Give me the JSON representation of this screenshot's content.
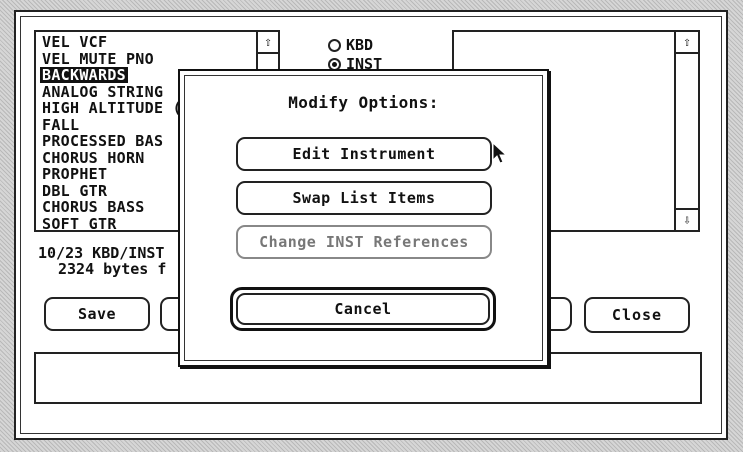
{
  "instrument_list": {
    "items": [
      {
        "label": "VEL VCF",
        "selected": false
      },
      {
        "label": "VEL MUTE PNO",
        "selected": false
      },
      {
        "label": "BACKWARDS",
        "selected": true
      },
      {
        "label": "ANALOG STRING",
        "selected": false
      },
      {
        "label": "HIGH ALTITUDE (",
        "selected": false
      },
      {
        "label": "FALL",
        "selected": false
      },
      {
        "label": "PROCESSED BAS",
        "selected": false
      },
      {
        "label": "CHORUS HORN",
        "selected": false
      },
      {
        "label": "PROPHET",
        "selected": false
      },
      {
        "label": "DBL GTR",
        "selected": false
      },
      {
        "label": "CHORUS BASS",
        "selected": false
      },
      {
        "label": "SOFT GTR",
        "selected": false
      }
    ]
  },
  "radios": {
    "kbd": {
      "label": "KBD",
      "checked": false
    },
    "inst": {
      "label": "INST",
      "checked": true
    }
  },
  "status": {
    "count_line": "10/23 KBD/INST",
    "bytes_line": "2324 bytes f"
  },
  "buttons": {
    "save_label": "Save",
    "close_label": "Close"
  },
  "modal": {
    "title": "Modify Options:",
    "edit_instrument_label": "Edit Instrument",
    "swap_list_items_label": "Swap List Items",
    "change_inst_references_label": "Change INST References",
    "change_inst_references_enabled": false,
    "cancel_label": "Cancel"
  },
  "icons": {
    "scroll_up": "arrow-up-icon",
    "scroll_down": "arrow-down-icon",
    "cursor": "mouse-pointer-icon"
  },
  "colors": {
    "ink": "#111111",
    "paper": "#ffffff",
    "dimmed": "#777777"
  }
}
